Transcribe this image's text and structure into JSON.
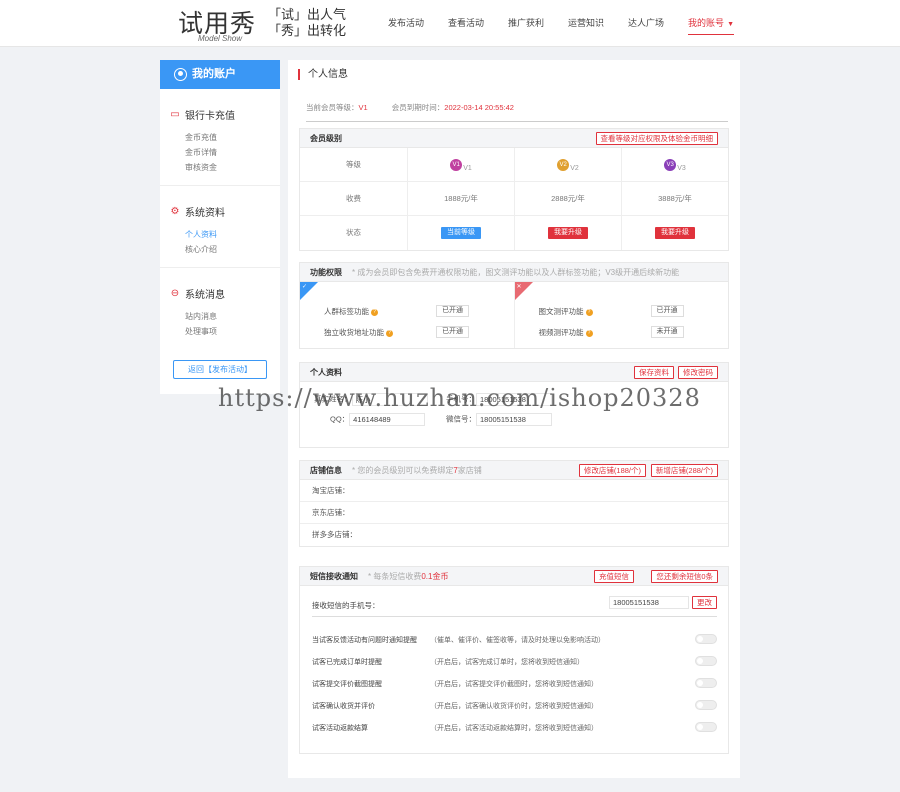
{
  "header": {
    "logo_main": "试用秀",
    "logo_sub": "Model Show",
    "slogan_line1": "「试」出人气",
    "slogan_line2": "「秀」出转化",
    "nav": [
      {
        "label": "发布活动"
      },
      {
        "label": "查看活动"
      },
      {
        "label": "推广获利"
      },
      {
        "label": "运营知识"
      },
      {
        "label": "达人广场"
      },
      {
        "label": "我的账号",
        "active": true,
        "caret": "▼"
      }
    ]
  },
  "sidebar": {
    "title": "我的账户",
    "groups": [
      {
        "title": "银行卡充值",
        "icon": "card-icon",
        "links": [
          {
            "label": "金币充值"
          },
          {
            "label": "金币详情"
          },
          {
            "label": "审核资金"
          }
        ]
      },
      {
        "title": "系统资料",
        "icon": "gear-icon",
        "links": [
          {
            "label": "个人资料",
            "active": true
          },
          {
            "label": "核心介绍"
          }
        ]
      },
      {
        "title": "系统消息",
        "icon": "minus-circle-icon",
        "links": [
          {
            "label": "站内消息"
          },
          {
            "label": "处理事项"
          }
        ]
      }
    ],
    "back_button": "返回【发布活动】"
  },
  "main": {
    "title": "个人信息",
    "meta": {
      "level_label": "当前会员等级：",
      "level_value": "V1",
      "time_label": "会员到期时间：",
      "time_value": "2022-03-14 20:55:42"
    },
    "membership": {
      "title": "会员级别",
      "action": "查看等级对应权限及体验金币明细",
      "row_labels": [
        "等级",
        "收费",
        "状态"
      ],
      "levels": [
        {
          "badge": "V1",
          "color": "#c040a0",
          "label": "V1",
          "price": "1888元/年",
          "status": "当前等级",
          "status_style": "blue"
        },
        {
          "badge": "V2",
          "color": "#e0a030",
          "label": "V2",
          "price": "2888元/年",
          "status": "我要升级",
          "status_style": "red"
        },
        {
          "badge": "V3",
          "color": "#8a3fb8",
          "label": "V3",
          "price": "3888元/年",
          "status": "我要升级",
          "status_style": "red"
        }
      ]
    },
    "privileges": {
      "title": "功能权限",
      "hint": "* 成为会员即包含免费开通权限功能，图文测评功能以及人群标签功能；V3级开通后续新功能",
      "left": [
        {
          "label": "人群标签功能",
          "status": "已开通"
        },
        {
          "label": "独立收货地址功能",
          "status": "已开通"
        }
      ],
      "right": [
        {
          "label": "图文测评功能",
          "status": "已开通"
        },
        {
          "label": "视频测评功能",
          "status": "未开通"
        }
      ]
    },
    "personal": {
      "title": "个人资料",
      "edit_btn": "保存资料",
      "pwd_btn": "修改密码",
      "fields": [
        {
          "label": "真实姓名：",
          "value": "陈小"
        },
        {
          "label": "手机号：",
          "value": "18005151538"
        },
        {
          "label": "QQ：",
          "value": "416148489"
        },
        {
          "label": "微信号：",
          "value": "18005151538"
        }
      ]
    },
    "shops": {
      "title": "店铺信息",
      "hint_prefix": "* 您的会员级别可以免费绑定",
      "hint_count": "7",
      "hint_suffix": "家店铺",
      "btn_edit": "修改店铺(188/个)",
      "btn_add": "新增店铺(288/个)",
      "rows": [
        {
          "label": "淘宝店铺："
        },
        {
          "label": "京东店铺："
        },
        {
          "label": "拼多多店铺："
        }
      ]
    },
    "sms": {
      "title": "短信接收通知",
      "hint_prefix": "* 每条短信收费",
      "hint_value": "0.1金币",
      "btn_recharge": "充值短信",
      "btn_remaining": "您还剩余短信0条",
      "phone_label": "接收短信的手机号：",
      "phone_value": "18005151538",
      "phone_btn": "更改",
      "items": [
        {
          "label": "当试客反馈活动有问题时通知提醒",
          "desc": "（催单、催评价、催签收等，请及时处理以免影响活动）"
        },
        {
          "label": "试客已完成订单时提醒",
          "desc": "（开启后，试客完成订单时，您将收到短信通知）"
        },
        {
          "label": "试客提交评价截图提醒",
          "desc": "（开启后，试客提交评价截图时，您将收到短信通知）"
        },
        {
          "label": "试客确认收货并评价",
          "desc": "（开启后，试客确认收货评价时，您将收到短信通知）"
        },
        {
          "label": "试客活动返款结算",
          "desc": "（开启后，试客活动返款结算时，您将收到短信通知）"
        }
      ]
    }
  },
  "watermark": "https://www.huzhan.com/ishop20328"
}
